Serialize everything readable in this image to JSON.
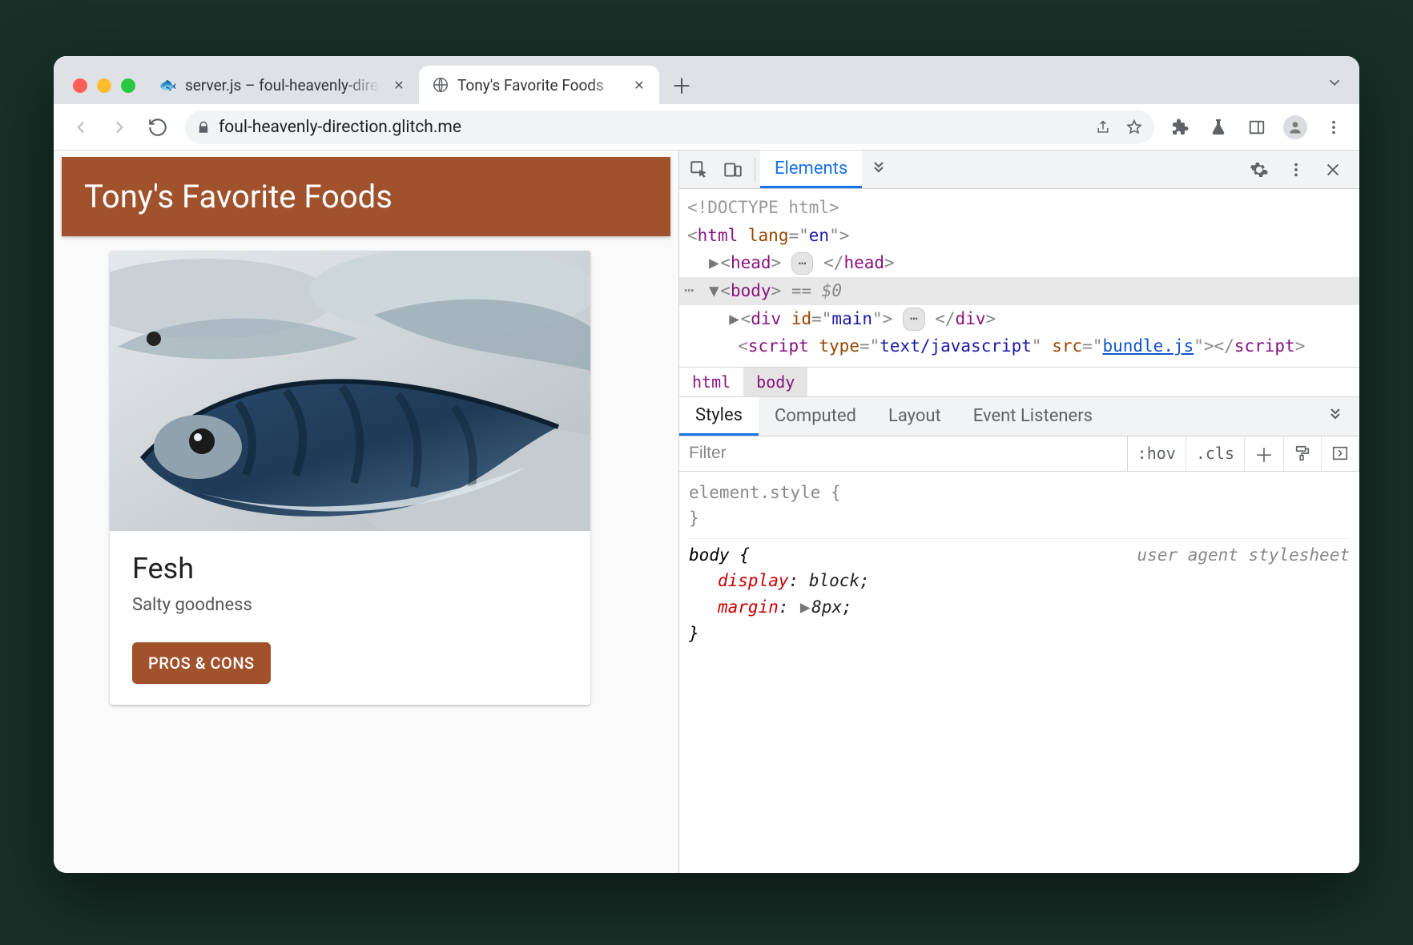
{
  "tabs": [
    {
      "label": "server.js – foul-heavenly-direct",
      "active": false
    },
    {
      "label": "Tony's Favorite Foods",
      "active": true
    }
  ],
  "url": "foul-heavenly-direction.glitch.me",
  "page": {
    "header": "Tony's Favorite Foods",
    "card": {
      "title": "Fesh",
      "subtitle": "Salty goodness",
      "button": "PROS & CONS"
    }
  },
  "devtools": {
    "main_tab": "Elements",
    "dom": {
      "doctype": "<!DOCTYPE html>",
      "html_open": {
        "tag": "html",
        "attr": "lang",
        "val": "en"
      },
      "head": "head",
      "body": {
        "tag": "body",
        "selmark": "== $0"
      },
      "div": {
        "tag": "div",
        "attr": "id",
        "val": "main"
      },
      "script": {
        "tag": "script",
        "attr1": "type",
        "val1": "text/javascript",
        "attr2": "src",
        "val2": "bundle.js"
      }
    },
    "breadcrumb": [
      "html",
      "body"
    ],
    "styles_tabs": [
      "Styles",
      "Computed",
      "Layout",
      "Event Listeners"
    ],
    "filter_placeholder": "Filter",
    "toolbar": {
      "hov": ":hov",
      "cls": ".cls"
    },
    "rules": {
      "inline": "element.style {",
      "body_sel": "body {",
      "uas": "user agent stylesheet",
      "p1": {
        "prop": "display",
        "val": "block"
      },
      "p2": {
        "prop": "margin",
        "val": "8px"
      }
    }
  }
}
